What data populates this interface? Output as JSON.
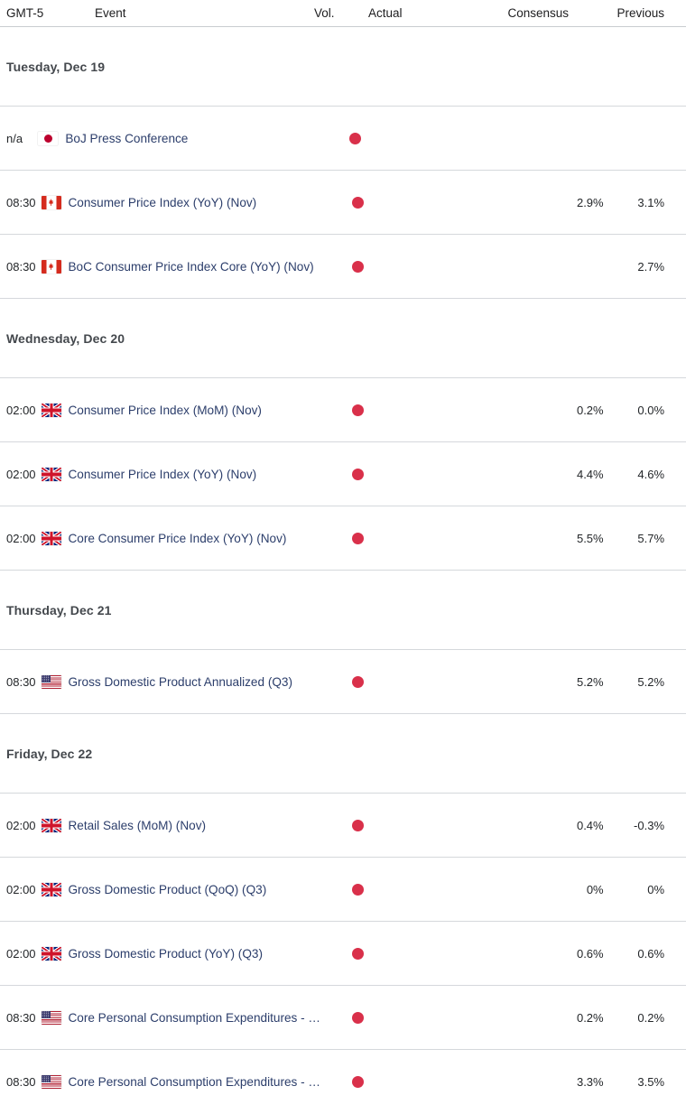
{
  "header": {
    "timezone": "GMT-5",
    "event": "Event",
    "vol": "Vol.",
    "actual": "Actual",
    "consensus": "Consensus",
    "previous": "Previous"
  },
  "colors": {
    "volatility_dot": "#d9304a",
    "event_link": "#2c3e6b",
    "day_heading": "#44484d",
    "row_border": "#d5d8dc",
    "header_border": "#c9ccd0"
  },
  "groups": [
    {
      "day": "Tuesday, Dec 19",
      "rows": [
        {
          "time": "n/a",
          "flag": "jp",
          "flag_name": "japan-flag",
          "event": "BoJ Press Conference",
          "vol": "high",
          "actual": "",
          "consensus": "",
          "previous": ""
        },
        {
          "time": "08:30",
          "flag": "ca",
          "flag_name": "canada-flag",
          "event": "Consumer Price Index (YoY) (Nov)",
          "vol": "high",
          "actual": "",
          "consensus": "2.9%",
          "previous": "3.1%"
        },
        {
          "time": "08:30",
          "flag": "ca",
          "flag_name": "canada-flag",
          "event": "BoC Consumer Price Index Core (YoY) (Nov)",
          "vol": "high",
          "actual": "",
          "consensus": "",
          "previous": "2.7%"
        }
      ]
    },
    {
      "day": "Wednesday, Dec 20",
      "rows": [
        {
          "time": "02:00",
          "flag": "gb",
          "flag_name": "united-kingdom-flag",
          "event": "Consumer Price Index (MoM) (Nov)",
          "vol": "high",
          "actual": "",
          "consensus": "0.2%",
          "previous": "0.0%"
        },
        {
          "time": "02:00",
          "flag": "gb",
          "flag_name": "united-kingdom-flag",
          "event": "Consumer Price Index (YoY) (Nov)",
          "vol": "high",
          "actual": "",
          "consensus": "4.4%",
          "previous": "4.6%"
        },
        {
          "time": "02:00",
          "flag": "gb",
          "flag_name": "united-kingdom-flag",
          "event": "Core Consumer Price Index (YoY) (Nov)",
          "vol": "high",
          "actual": "",
          "consensus": "5.5%",
          "previous": "5.7%"
        }
      ]
    },
    {
      "day": "Thursday, Dec 21",
      "rows": [
        {
          "time": "08:30",
          "flag": "us",
          "flag_name": "united-states-flag",
          "event": "Gross Domestic Product Annualized (Q3)",
          "vol": "high",
          "actual": "",
          "consensus": "5.2%",
          "previous": "5.2%"
        }
      ]
    },
    {
      "day": "Friday, Dec 22",
      "rows": [
        {
          "time": "02:00",
          "flag": "gb",
          "flag_name": "united-kingdom-flag",
          "event": "Retail Sales (MoM) (Nov)",
          "vol": "high",
          "actual": "",
          "consensus": "0.4%",
          "previous": "-0.3%"
        },
        {
          "time": "02:00",
          "flag": "gb",
          "flag_name": "united-kingdom-flag",
          "event": "Gross Domestic Product (QoQ) (Q3)",
          "vol": "high",
          "actual": "",
          "consensus": "0%",
          "previous": "0%"
        },
        {
          "time": "02:00",
          "flag": "gb",
          "flag_name": "united-kingdom-flag",
          "event": "Gross Domestic Product (YoY) (Q3)",
          "vol": "high",
          "actual": "",
          "consensus": "0.6%",
          "previous": "0.6%"
        },
        {
          "time": "08:30",
          "flag": "us",
          "flag_name": "united-states-flag",
          "event": "Core Personal Consumption Expenditures - …",
          "vol": "high",
          "actual": "",
          "consensus": "0.2%",
          "previous": "0.2%"
        },
        {
          "time": "08:30",
          "flag": "us",
          "flag_name": "united-states-flag",
          "event": "Core Personal Consumption Expenditures - …",
          "vol": "high",
          "actual": "",
          "consensus": "3.3%",
          "previous": "3.5%"
        }
      ]
    }
  ]
}
